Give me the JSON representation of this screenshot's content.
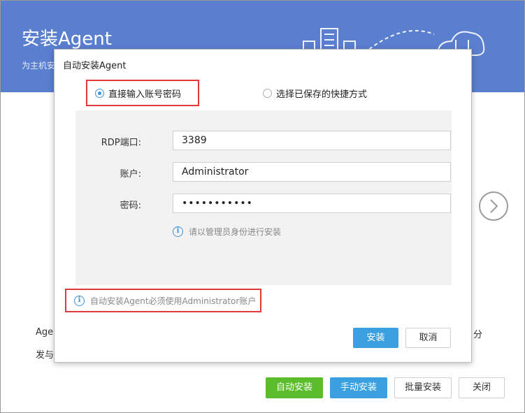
{
  "window": {
    "title": "安装Agent",
    "subtitle": "为主机安",
    "body_text_1": "Age",
    "body_text_2": "发与",
    "body_text_3": "分"
  },
  "footer_buttons": {
    "auto_install": "自动安装",
    "manual_install": "手动安装",
    "batch_install": "批量安装",
    "close": "关闭"
  },
  "dialog": {
    "title": "自动安装Agent",
    "options": [
      {
        "label": "直接输入账号密码",
        "checked": true
      },
      {
        "label": "选择已保存的快捷方式",
        "checked": false
      }
    ],
    "fields": {
      "rdp_label": "RDP端口:",
      "rdp_value": "3389",
      "account_label": "账户:",
      "account_value": "Administrator",
      "password_label": "密码:",
      "password_value": "•••••••••••"
    },
    "hint_admin": "请以管理员身份进行安装",
    "hint_must_admin": "自动安装Agent必须使用Administrator账户",
    "install_button": "安装",
    "cancel_button": "取消"
  },
  "colors": {
    "header_bg": "#5b7fcf",
    "primary_blue": "#3aa0e0",
    "green": "#5bbd2b",
    "highlight_red": "#e23a3a"
  }
}
